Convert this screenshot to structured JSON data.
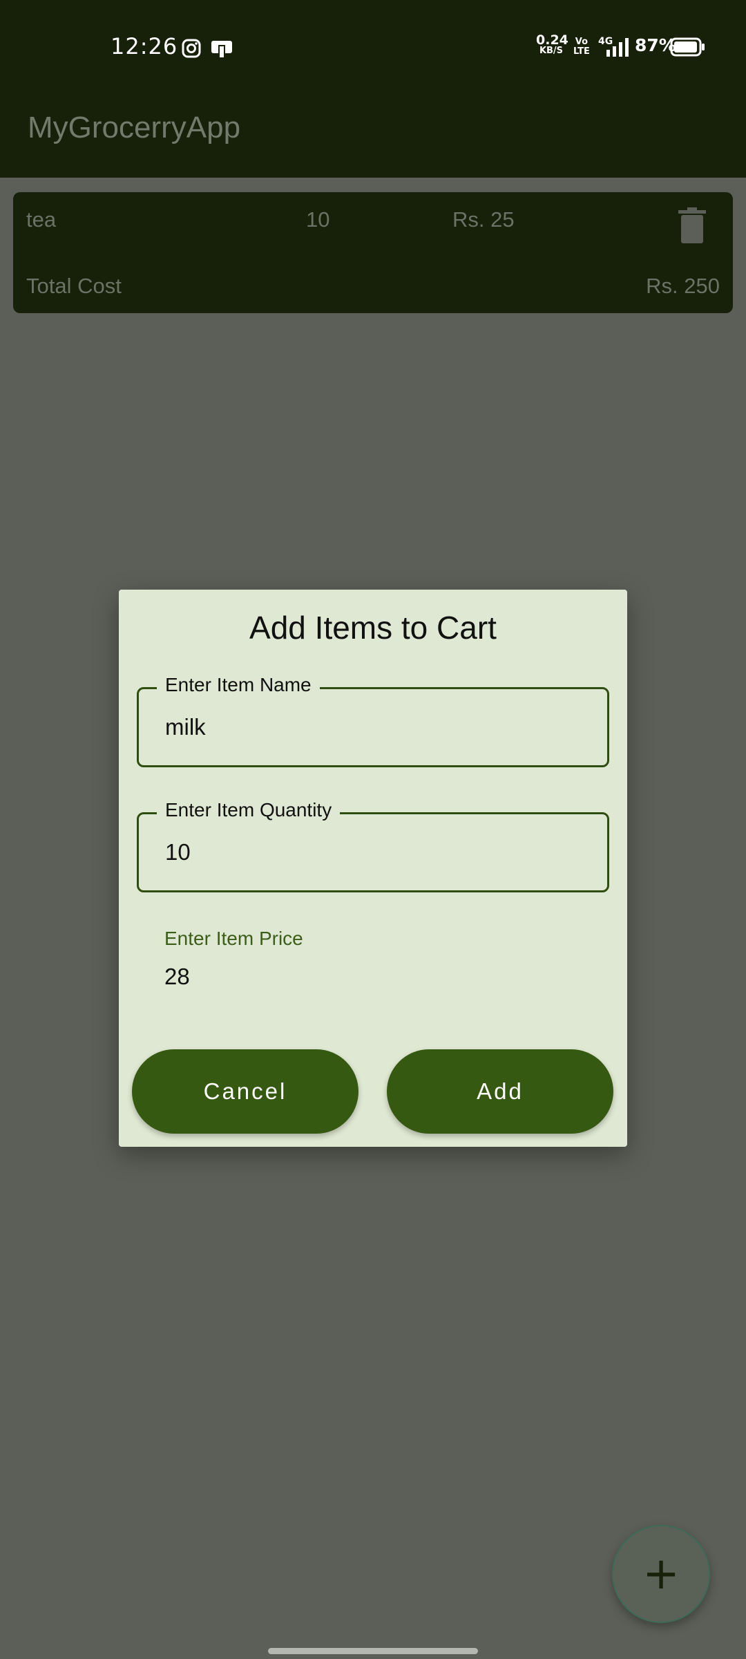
{
  "status_bar": {
    "time": "12:26",
    "net_rate": "0.24",
    "net_unit": "KB/S",
    "volte_top": "Vo",
    "volte_bottom": "LTE",
    "network": "4G",
    "battery": "87%"
  },
  "app_bar": {
    "title": "MyGrocerryApp"
  },
  "cart": {
    "item": {
      "name": "tea",
      "quantity": "10",
      "price": "Rs. 25"
    },
    "total_label": "Total Cost",
    "total_value": "Rs. 250"
  },
  "dialog": {
    "title": "Add Items to Cart",
    "name_field": {
      "label": "Enter Item Name",
      "value": "milk"
    },
    "quantity_field": {
      "label": "Enter Item Quantity",
      "value": "10"
    },
    "price_field": {
      "label": "Enter Item Price",
      "value": "28"
    },
    "cancel_label": "Cancel",
    "add_label": "Add"
  },
  "fab": {
    "icon": "plus-icon",
    "symbol": "+"
  },
  "colors": {
    "app_bar_bg": "#172008",
    "scrim": "#5c5f57",
    "dialog_bg": "#dfe8d2",
    "accent": "#365911"
  }
}
